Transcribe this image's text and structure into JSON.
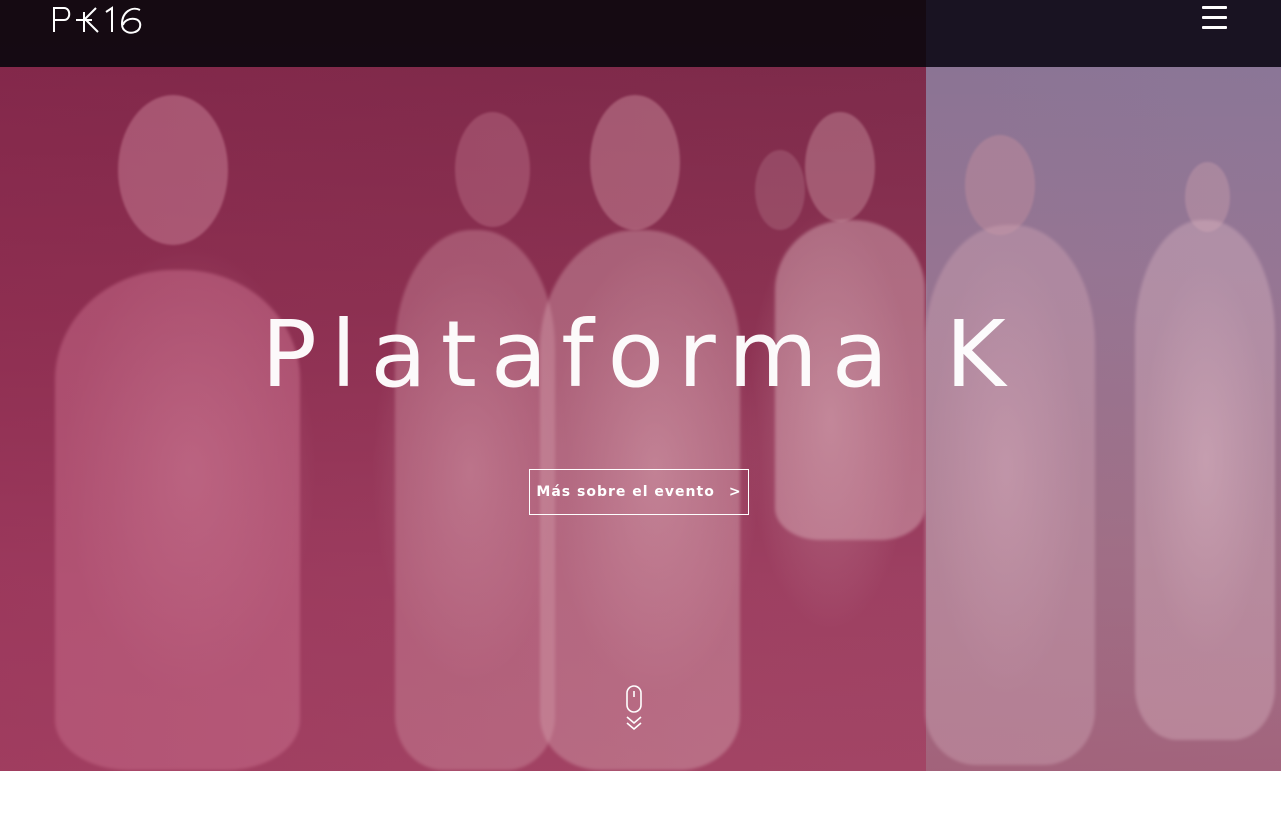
{
  "header": {
    "logo_text": "P+K16",
    "menu_icon": "hamburger-menu-icon"
  },
  "hero": {
    "title": "Plataforma K",
    "cta_label": "Más sobre el evento",
    "cta_arrow": ">",
    "scroll_icon": "mouse-scroll-down-icon"
  },
  "colors": {
    "topbar": "#0c080e",
    "hero_tint": "#8e3555",
    "text": "#ffffff"
  }
}
